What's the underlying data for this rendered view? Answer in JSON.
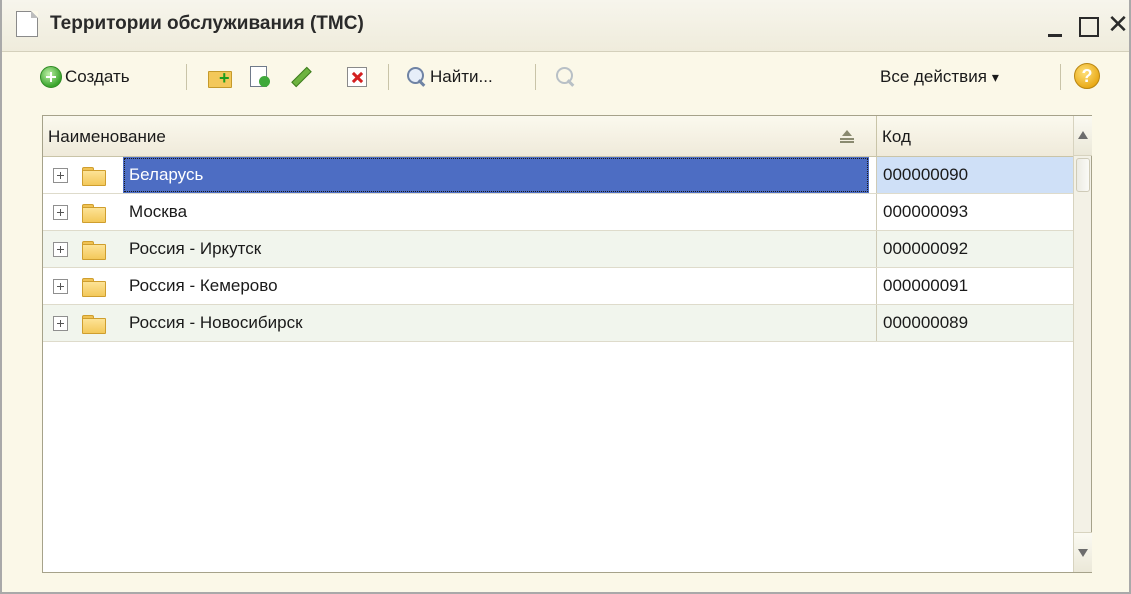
{
  "window": {
    "title": "Территории обслуживания (ТМС)",
    "controls": {
      "minimize": "",
      "maximize": "",
      "close": "✕"
    }
  },
  "toolbar": {
    "create_label": "Создать",
    "find_label": "Найти...",
    "all_actions_label": "Все действия",
    "all_actions_caret": "▾",
    "help_label": "?"
  },
  "table": {
    "columns": [
      "Наименование",
      "Код"
    ],
    "rows": [
      {
        "name": "Беларусь",
        "code": "000000090",
        "selected": true
      },
      {
        "name": "Москва",
        "code": "000000093",
        "selected": false
      },
      {
        "name": "Россия - Иркутск",
        "code": "000000092",
        "selected": false
      },
      {
        "name": "Россия - Кемерово",
        "code": "000000091",
        "selected": false
      },
      {
        "name": "Россия - Новосибирск",
        "code": "000000089",
        "selected": false
      }
    ]
  },
  "colors": {
    "selection": "#4d6dc3",
    "selected_code_cell": "#cfe0f7",
    "alt_row": "#f1f5ed",
    "window_background": "#fbf8e8"
  },
  "icons": [
    "page-icon",
    "plus-circle-icon",
    "folder-add-icon",
    "copy-icon",
    "pencil-icon",
    "delete-icon",
    "search-icon",
    "cancel-search-icon",
    "help-icon",
    "sort-icon",
    "expand-icon",
    "folder-icon"
  ]
}
